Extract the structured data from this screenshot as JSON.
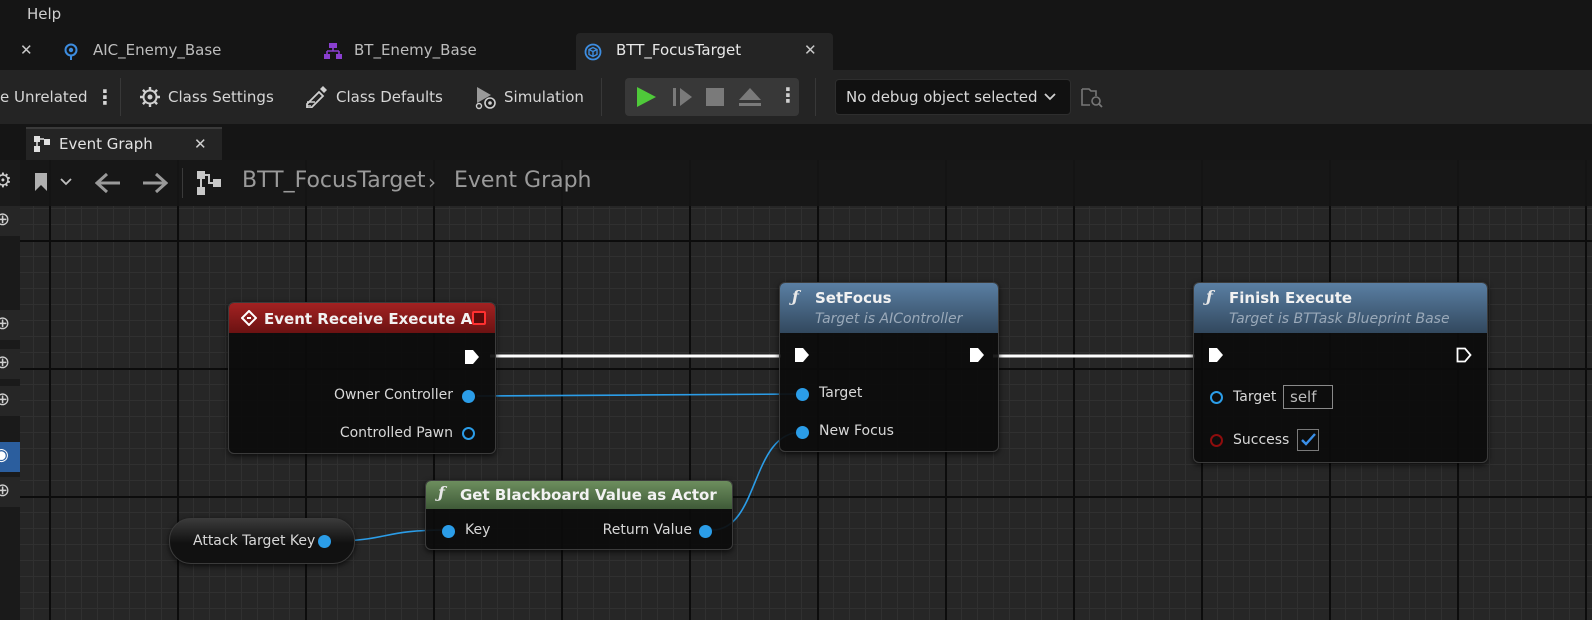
{
  "menu": {
    "help": "Help"
  },
  "doc_tabs": [
    {
      "label": "AIC_Enemy_Base"
    },
    {
      "label": "BT_Enemy_Base"
    },
    {
      "label": "BTT_FocusTarget"
    }
  ],
  "toolbar": {
    "partial_label": "e Unrelated",
    "class_settings": "Class Settings",
    "class_defaults": "Class Defaults",
    "simulation": "Simulation",
    "debug_object": "No debug object selected"
  },
  "graph_tab": {
    "label": "Event Graph"
  },
  "breadcrumb": {
    "root": "BTT_FocusTarget",
    "current": "Event Graph"
  },
  "nodes": {
    "event": {
      "title": "Event Receive Execute AI",
      "pins": [
        "Owner Controller",
        "Controlled Pawn"
      ]
    },
    "setfocus": {
      "title": "SetFocus",
      "subtitle": "Target is AIController",
      "pins": [
        "Target",
        "New Focus"
      ]
    },
    "finish": {
      "title": "Finish Execute",
      "subtitle": "Target is BTTask Blueprint Base",
      "pins": [
        "Target",
        "Success"
      ],
      "target_default": "self"
    },
    "getbb": {
      "title": "Get Blackboard Value as Actor",
      "pins": [
        "Key",
        "Return Value"
      ]
    },
    "var": {
      "label": "Attack Target Key"
    }
  },
  "colors": {
    "event_header": "#8a1a1a",
    "function_header": "#4c6c8c",
    "pure_header": "#4f6f45",
    "object_pin": "#2b9de8",
    "exec_wire": "#ffffff"
  }
}
